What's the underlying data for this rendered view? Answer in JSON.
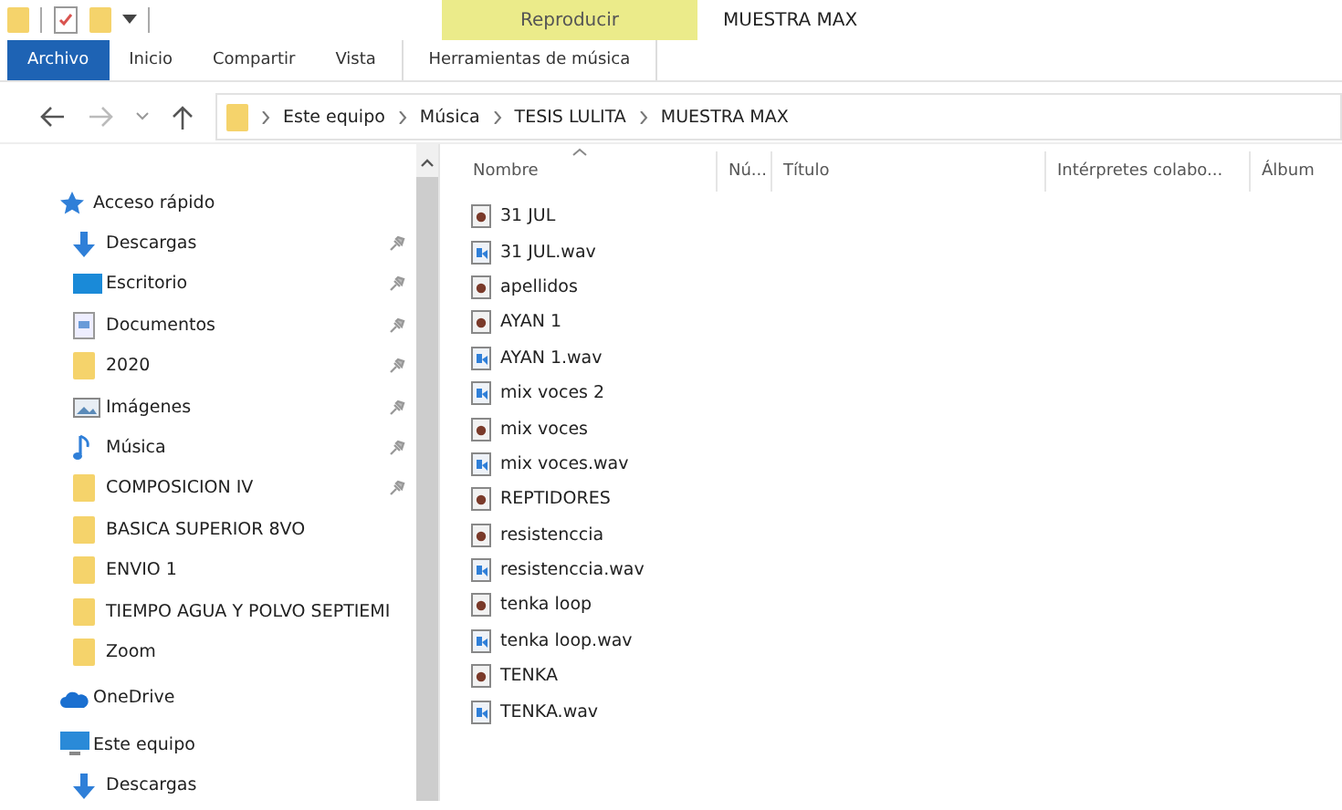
{
  "window": {
    "title": "MUESTRA MAX",
    "context_label": "Reproducir"
  },
  "ribbon_tabs": [
    {
      "label": "Archivo",
      "kind": "file",
      "selected": false
    },
    {
      "label": "Inicio",
      "kind": "tab",
      "selected": false
    },
    {
      "label": "Compartir",
      "kind": "tab",
      "selected": false
    },
    {
      "label": "Vista",
      "kind": "tab",
      "selected": false
    },
    {
      "label": "Herramientas de música",
      "kind": "context",
      "selected": false
    }
  ],
  "breadcrumb": [
    "Este equipo",
    "Música",
    "TESIS LULITA",
    "MUESTRA MAX"
  ],
  "sidebar": {
    "items": [
      {
        "label": "Acceso rápido",
        "kind": "star",
        "pinned": false,
        "section": true
      },
      {
        "label": "Descargas",
        "kind": "download",
        "pinned": true,
        "section": false
      },
      {
        "label": "Escritorio",
        "kind": "desktop",
        "pinned": true,
        "section": false
      },
      {
        "label": "Documentos",
        "kind": "document",
        "pinned": true,
        "section": false
      },
      {
        "label": "2020",
        "kind": "folder",
        "pinned": true,
        "section": false
      },
      {
        "label": "Imágenes",
        "kind": "image",
        "pinned": true,
        "section": false
      },
      {
        "label": "Música",
        "kind": "music",
        "pinned": true,
        "section": false
      },
      {
        "label": "COMPOSICION IV",
        "kind": "folder",
        "pinned": true,
        "section": false
      },
      {
        "label": "BASICA SUPERIOR 8VO",
        "kind": "folder",
        "pinned": false,
        "section": false
      },
      {
        "label": "ENVIO 1",
        "kind": "folder",
        "pinned": false,
        "section": false
      },
      {
        "label": "TIEMPO AGUA Y POLVO SEPTIEMI",
        "kind": "folder",
        "pinned": false,
        "section": false
      },
      {
        "label": "Zoom",
        "kind": "folder",
        "pinned": false,
        "section": false
      },
      {
        "label": "OneDrive",
        "kind": "cloud",
        "pinned": false,
        "section": true
      },
      {
        "label": "Este equipo",
        "kind": "computer",
        "pinned": false,
        "section": true
      },
      {
        "label": "Descargas",
        "kind": "download",
        "pinned": false,
        "section": false
      }
    ]
  },
  "table": {
    "columns": [
      "Nombre",
      "Nú...",
      "Título",
      "Intérpretes colabo...",
      "Álbum"
    ],
    "rows": [
      {
        "name": "31 JUL",
        "kind": "project"
      },
      {
        "name": "31 JUL.wav",
        "kind": "wav"
      },
      {
        "name": "apellidos",
        "kind": "project"
      },
      {
        "name": "AYAN 1",
        "kind": "project"
      },
      {
        "name": "AYAN 1.wav",
        "kind": "wav"
      },
      {
        "name": "mix voces 2",
        "kind": "wav"
      },
      {
        "name": "mix voces",
        "kind": "project"
      },
      {
        "name": "mix voces.wav",
        "kind": "wav"
      },
      {
        "name": "REPTIDORES",
        "kind": "project"
      },
      {
        "name": "resistenccia",
        "kind": "project"
      },
      {
        "name": "resistenccia.wav",
        "kind": "wav"
      },
      {
        "name": "tenka loop",
        "kind": "project"
      },
      {
        "name": "tenka loop.wav",
        "kind": "wav"
      },
      {
        "name": "TENKA",
        "kind": "project"
      },
      {
        "name": "TENKA.wav",
        "kind": "wav"
      }
    ]
  }
}
